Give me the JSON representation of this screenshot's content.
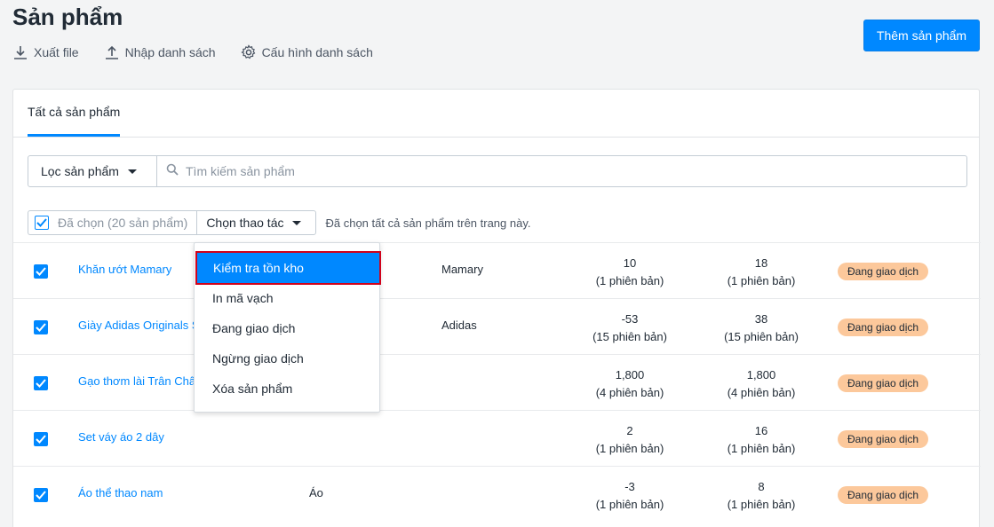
{
  "page": {
    "title": "Sản phẩm"
  },
  "toolbar": {
    "export_label": "Xuất file",
    "import_label": "Nhập danh sách",
    "config_label": "Cấu hình danh sách",
    "add_button": "Thêm sản phẩm"
  },
  "tabs": [
    {
      "label": "Tất cả sản phẩm",
      "active": true
    }
  ],
  "filter": {
    "filter_label": "Lọc sản phẩm",
    "search_placeholder": "Tìm kiếm sản phẩm"
  },
  "bulk": {
    "selected_label": "Đã chọn (20 sản phẩm)",
    "action_label": "Chọn thao tác",
    "note": "Đã chọn tất cả sản phẩm trên trang này."
  },
  "dropdown": {
    "items": [
      "Kiểm tra tồn kho",
      "In mã vạch",
      "Đang giao dịch",
      "Ngừng giao dịch",
      "Xóa sản phẩm"
    ],
    "highlighted": "Kiểm tra tồn kho"
  },
  "rows": [
    {
      "name": "Khăn ướt Mamary",
      "type": "",
      "brand": "Mamary",
      "stock": "10",
      "stock_variants": "(1 phiên bản)",
      "available": "18",
      "available_variants": "(1 phiên bản)",
      "status": "Đang giao dịch"
    },
    {
      "name": "Giày Adidas Originals Superstar",
      "type": "",
      "brand": "Adidas",
      "stock": "-53",
      "stock_variants": "(15 phiên bản)",
      "available": "38",
      "available_variants": "(15 phiên bản)",
      "status": "Đang giao dịch"
    },
    {
      "name": "Gạo thơm lài Trân Châu",
      "type": "",
      "brand": "",
      "stock": "1,800",
      "stock_variants": "(4 phiên bản)",
      "available": "1,800",
      "available_variants": "(4 phiên bản)",
      "status": "Đang giao dịch"
    },
    {
      "name": "Set váy áo 2 dây",
      "type": "",
      "brand": "",
      "stock": "2",
      "stock_variants": "(1 phiên bản)",
      "available": "16",
      "available_variants": "(1 phiên bản)",
      "status": "Đang giao dịch"
    },
    {
      "name": "Áo thể thao nam",
      "type": "Áo",
      "brand": "",
      "stock": "-3",
      "stock_variants": "(1 phiên bản)",
      "available": "8",
      "available_variants": "(1 phiên bản)",
      "status": "Đang giao dịch"
    }
  ],
  "colors": {
    "accent": "#0088ff",
    "badge": "#fcc89b",
    "highlight_border": "#d0021b"
  }
}
